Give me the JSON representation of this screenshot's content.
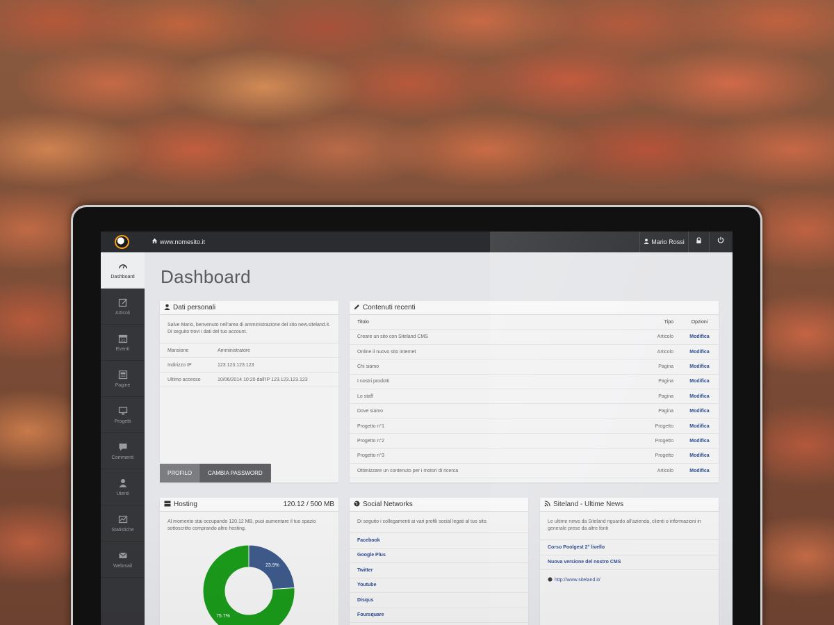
{
  "topbar": {
    "site": "www.nomesito.it",
    "user": "Mario Rossi"
  },
  "sidebar": {
    "items": [
      {
        "label": "Dashboard",
        "icon": "dashboard-icon"
      },
      {
        "label": "Articoli",
        "icon": "edit-icon"
      },
      {
        "label": "Eventi",
        "icon": "calendar-icon"
      },
      {
        "label": "Pagine",
        "icon": "page-icon"
      },
      {
        "label": "Progetti",
        "icon": "monitor-icon"
      },
      {
        "label": "Commenti",
        "icon": "comment-icon"
      },
      {
        "label": "Utenti",
        "icon": "user-icon"
      },
      {
        "label": "Statistiche",
        "icon": "chart-icon"
      },
      {
        "label": "Webmail",
        "icon": "mail-icon"
      }
    ]
  },
  "page": {
    "title": "Dashboard"
  },
  "personal": {
    "title": "Dati personali",
    "intro": "Salve Mario, benvenuto nell'area di amministrazione del sito new.siteland.it. Di seguito trovi i dati del tuo account.",
    "rows": [
      {
        "k": "Mansione",
        "v": "Amministratore"
      },
      {
        "k": "Indirizzo IP",
        "v": "123.123.123.123"
      },
      {
        "k": "Ultimo accesso",
        "v": "10/06/2014 10:20 dall'IP 123.123.123.123"
      }
    ],
    "btn_profile": "PROFILO",
    "btn_password": "CAMBIA PASSWORD"
  },
  "recent": {
    "title": "Contenuti recenti",
    "headers": {
      "title": "Titolo",
      "type": "Tipo",
      "options": "Opzioni"
    },
    "rows": [
      {
        "title": "Creare un sito con Siteland CMS",
        "type": "Articolo",
        "action": "Modifica"
      },
      {
        "title": "Online il nuovo sito internet",
        "type": "Articolo",
        "action": "Modifica"
      },
      {
        "title": "Chi siamo",
        "type": "Pagina",
        "action": "Modifica"
      },
      {
        "title": "I nostri prodotti",
        "type": "Pagina",
        "action": "Modifica"
      },
      {
        "title": "Lo staff",
        "type": "Pagina",
        "action": "Modifica"
      },
      {
        "title": "Dove siamo",
        "type": "Pagina",
        "action": "Modifica"
      },
      {
        "title": "Progetto n°1",
        "type": "Progetto",
        "action": "Modifica"
      },
      {
        "title": "Progetto n°2",
        "type": "Progetto",
        "action": "Modifica"
      },
      {
        "title": "Progetto n°3",
        "type": "Progetto",
        "action": "Modifica"
      },
      {
        "title": "Ottimizzare un contenuto per i motori di ricerca",
        "type": "Articolo",
        "action": "Modifica"
      }
    ]
  },
  "hosting": {
    "title": "Hosting",
    "usage": "120.12 / 500 MB",
    "text": "Al momento stai occupando 120.12 MB, puoi aumentare il tuo spazio sottoscritto comprando altro hosting.",
    "used_label": "23.9%",
    "free_label": "75.7%",
    "used_fraction": 0.239,
    "colors": {
      "used": "#3d5a8a",
      "free": "#1a9a1a"
    }
  },
  "social": {
    "title": "Social Networks",
    "text": "Di seguito i collegamenti ai vari profili social legati al tuo sito.",
    "links": [
      "Facebook",
      "Google Plus",
      "Twitter",
      "Youtube",
      "Disqus",
      "Foursquare"
    ]
  },
  "news": {
    "title": "Siteland - Ultime News",
    "text": "Le ultime news da Siteland riguardo all'azienda, clienti o informazioni in generale prese da altre fonti",
    "links": [
      "Corso Poolgest 2° livello",
      "Nuova versione del nostro CMS"
    ],
    "url": "http://www.siteland.it/"
  }
}
